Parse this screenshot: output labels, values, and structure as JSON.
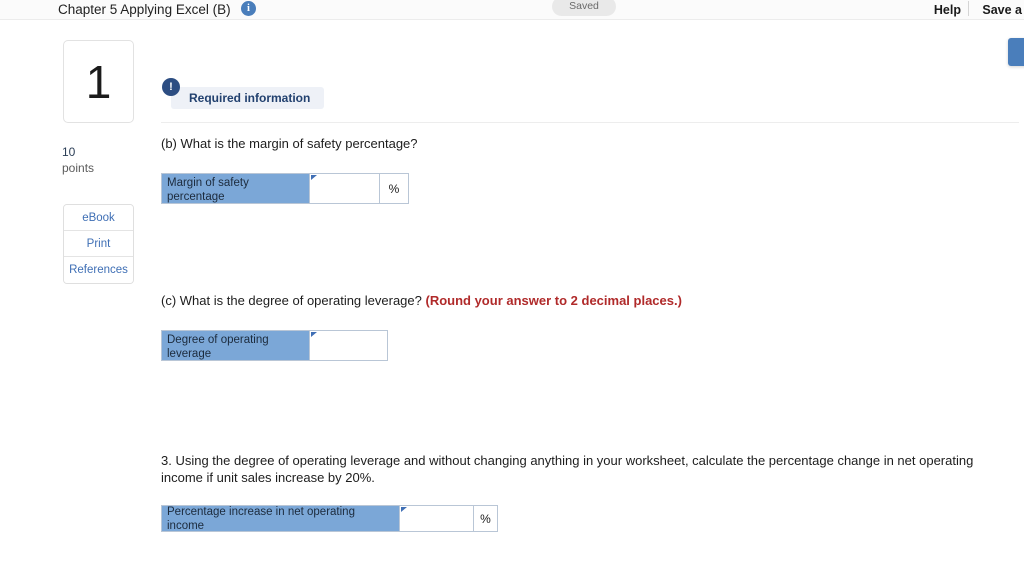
{
  "header": {
    "title": "Chapter 5 Applying Excel (B)",
    "info_icon": "info-icon",
    "status_pill": "Saved",
    "help_label": "Help",
    "save_label": "Save a"
  },
  "rail": {
    "question_number": "1",
    "points_value": "10",
    "points_label": "points",
    "buttons": [
      {
        "label": "eBook"
      },
      {
        "label": "Print"
      },
      {
        "label": "References"
      }
    ]
  },
  "notice": {
    "icon": "exclamation-icon",
    "label": "Required information"
  },
  "questions": [
    {
      "id": "b",
      "prompt": "(b) What is the margin of safety percentage?",
      "hint": "",
      "table": {
        "label": "Margin of safety percentage",
        "value": "",
        "unit": "%"
      }
    },
    {
      "id": "c",
      "prompt": "(c) What is the degree of operating leverage? ",
      "hint": "(Round your answer to 2 decimal places.)",
      "table": {
        "label": "Degree of operating leverage",
        "value": "",
        "unit": ""
      }
    },
    {
      "id": "3",
      "prompt": "3. Using the degree of operating leverage and without changing anything in your worksheet, calculate the percentage change in net operating income if unit sales increase by 20%.",
      "hint": "",
      "table": {
        "label": "Percentage increase in net operating income",
        "value": "",
        "unit": "%"
      }
    }
  ],
  "colors": {
    "accent_blue": "#4a7ebb",
    "label_cell_blue": "#7ba7d7",
    "notice_navy": "#2c4d82",
    "hint_red": "#b02a2a",
    "link_blue": "#3f6fb5"
  }
}
